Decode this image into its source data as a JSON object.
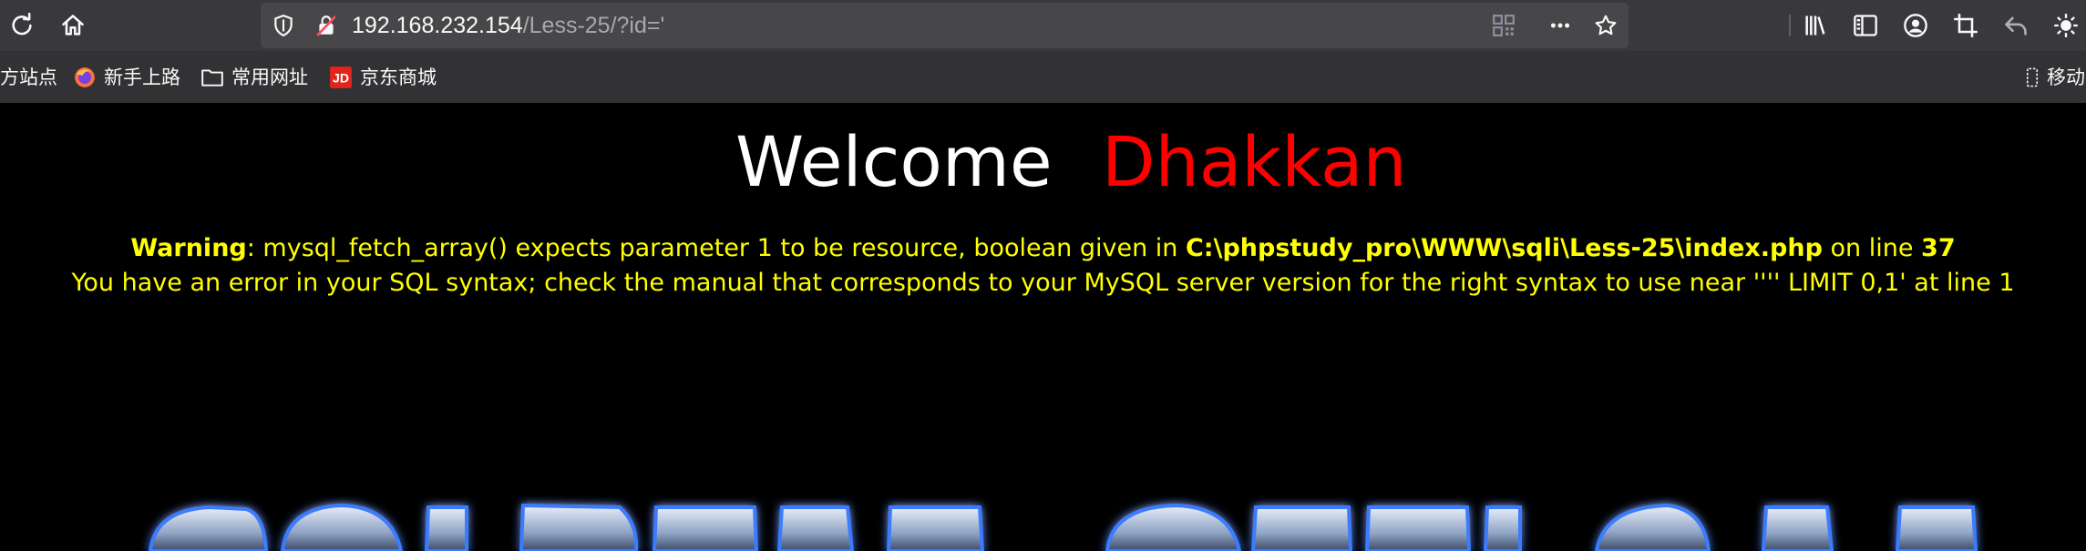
{
  "url": {
    "host": "192.168.232.154",
    "path": "/Less-25/?id='"
  },
  "bookmarks": [
    {
      "label": "方站点",
      "icon": "none"
    },
    {
      "label": "新手上路",
      "icon": "firefox-icon"
    },
    {
      "label": "常用网址",
      "icon": "folder-icon"
    },
    {
      "label": "京东商城",
      "icon": "jd-icon"
    }
  ],
  "mobile_bookmarks": "移动",
  "welcome": {
    "word": "Welcome",
    "name": "Dhakkan"
  },
  "warning": {
    "label": "Warning",
    "message": ": mysql_fetch_array() expects parameter 1 to be resource, boolean given in ",
    "file": "C:\\phpstudy_pro\\WWW\\sqli\\Less-25\\index.php",
    "on_line": " on line ",
    "line": "37"
  },
  "sql_error": "You have an error in your SQL syntax; check the manual that corresponds to your MySQL server version for the right syntax to use near '''' LIMIT 0,1' at line 1",
  "colors": {
    "toolbar": "#38383d",
    "urlbar": "#474749",
    "bookmarks_bar": "#323234",
    "page_bg": "#000000",
    "welcome": "#ffffff",
    "name": "#ff0000",
    "error_text": "#ffff00"
  }
}
